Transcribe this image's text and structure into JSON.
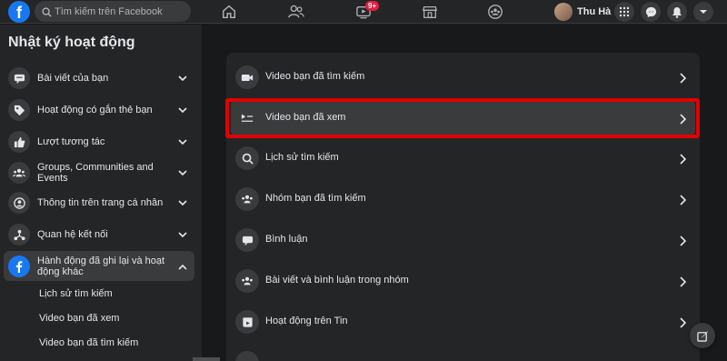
{
  "topbar": {
    "logo_letter": "f",
    "search_placeholder": "Tìm kiếm trên Facebook",
    "notification_badge": "9+",
    "profile_name": "Thu Hà"
  },
  "sidebar": {
    "title": "Nhật ký hoạt động",
    "items": [
      {
        "label": "Bài viết của bạn",
        "icon": "speech-bubble-icon"
      },
      {
        "label": "Hoạt động có gắn thẻ bạn",
        "icon": "tag-icon"
      },
      {
        "label": "Lượt tương tác",
        "icon": "thumbs-up-icon"
      },
      {
        "label": "Groups, Communities and Events",
        "icon": "people-icon"
      },
      {
        "label": "Thông tin trên trang cá nhân",
        "icon": "person-icon"
      },
      {
        "label": "Quan hệ kết nối",
        "icon": "connections-icon"
      },
      {
        "label": "Hành động đã ghi lại và hoạt động khác",
        "icon": "facebook-icon",
        "active": true
      }
    ],
    "sub_items": [
      "Lịch sử tìm kiếm",
      "Video bạn đã xem",
      "Video bạn đã tìm kiếm"
    ]
  },
  "main": {
    "rows": [
      {
        "label": "Video bạn đã tìm kiếm",
        "icon": "video-camera-icon"
      },
      {
        "label": "Video bạn đã xem",
        "icon": "video-list-icon",
        "highlighted": true
      },
      {
        "label": "Lịch sử tìm kiếm",
        "icon": "search-icon"
      },
      {
        "label": "Nhóm bạn đã tìm kiếm",
        "icon": "group-icon"
      },
      {
        "label": "Bình luận",
        "icon": "comment-icon"
      },
      {
        "label": "Bài viết và bình luận trong nhóm",
        "icon": "group-icon"
      },
      {
        "label": "Hoạt động trên Tin",
        "icon": "story-icon"
      }
    ]
  },
  "colors": {
    "background": "#18191a",
    "surface": "#242526",
    "hover": "#3a3b3c",
    "accent": "#1877f2",
    "highlight_border": "#e00000",
    "badge": "#e41e3f"
  }
}
